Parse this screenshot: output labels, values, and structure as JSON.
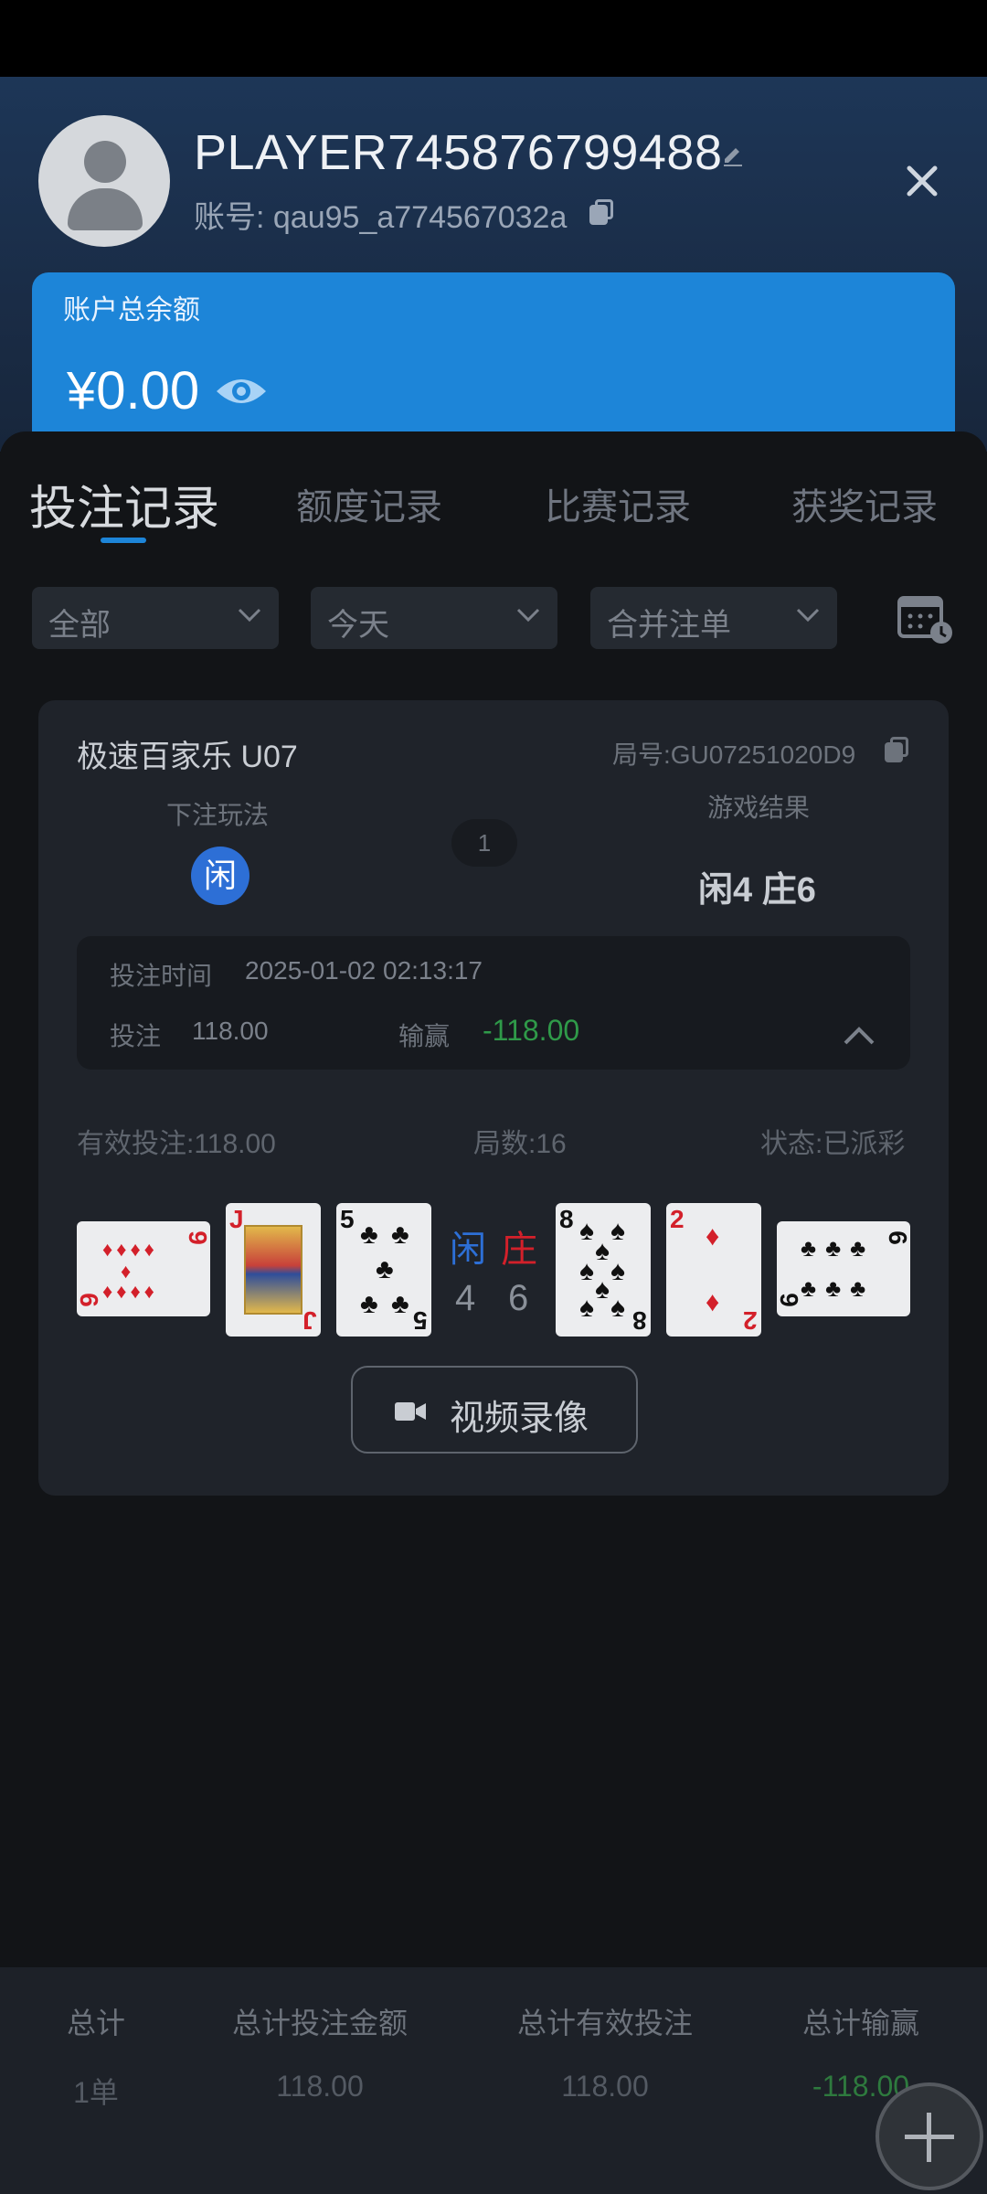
{
  "profile": {
    "name": "PLAYER745876799488",
    "account": "账号: qau95_a774567032a"
  },
  "balance": {
    "label": "账户总余额",
    "value": "¥0.00"
  },
  "tabs": [
    {
      "label": "投注记录",
      "active": true
    },
    {
      "label": "额度记录",
      "active": false
    },
    {
      "label": "比赛记录",
      "active": false
    },
    {
      "label": "获奖记录",
      "active": false
    }
  ],
  "filters": {
    "type": "全部",
    "date": "今天",
    "merge": "合并注单"
  },
  "record": {
    "game": "极速百家乐 U07",
    "round_no": "局号:GU07251020D9",
    "bet_play_label": "下注玩法",
    "bet_choice": "闲",
    "count": "1",
    "result_label": "游戏结果",
    "result": "闲4 庄6",
    "bet_time_label": "投注时间",
    "bet_time": "2025-01-02 02:13:17",
    "bet_label": "投注",
    "bet_amount": "118.00",
    "winloss_label": "输赢",
    "winloss": "-118.00",
    "valid_bet": "有效投注:118.00",
    "rounds": "局数:16",
    "status": "状态:已派彩",
    "player_label": "闲",
    "banker_label": "庄",
    "player_score": "4",
    "banker_score": "6",
    "player_cards": [
      {
        "rank": "9",
        "suit": "♦",
        "color": "red"
      },
      {
        "rank": "J",
        "suit": "♥",
        "color": "red"
      },
      {
        "rank": "5",
        "suit": "♣",
        "color": "black"
      }
    ],
    "banker_cards": [
      {
        "rank": "8",
        "suit": "♠",
        "color": "black"
      },
      {
        "rank": "2",
        "suit": "♦",
        "color": "red"
      },
      {
        "rank": "6",
        "suit": "♣",
        "color": "black"
      }
    ],
    "video_label": "视频录像"
  },
  "summary": [
    {
      "label": "总计",
      "value": "1单"
    },
    {
      "label": "总计投注金额",
      "value": "118.00"
    },
    {
      "label": "总计有效投注",
      "value": "118.00"
    },
    {
      "label": "总计输赢",
      "value": "-118.00"
    }
  ],
  "colors": {
    "accent": "#1d85d8",
    "player": "#2d6fd6",
    "banker": "#d3202a",
    "loss": "#2f9a49"
  }
}
